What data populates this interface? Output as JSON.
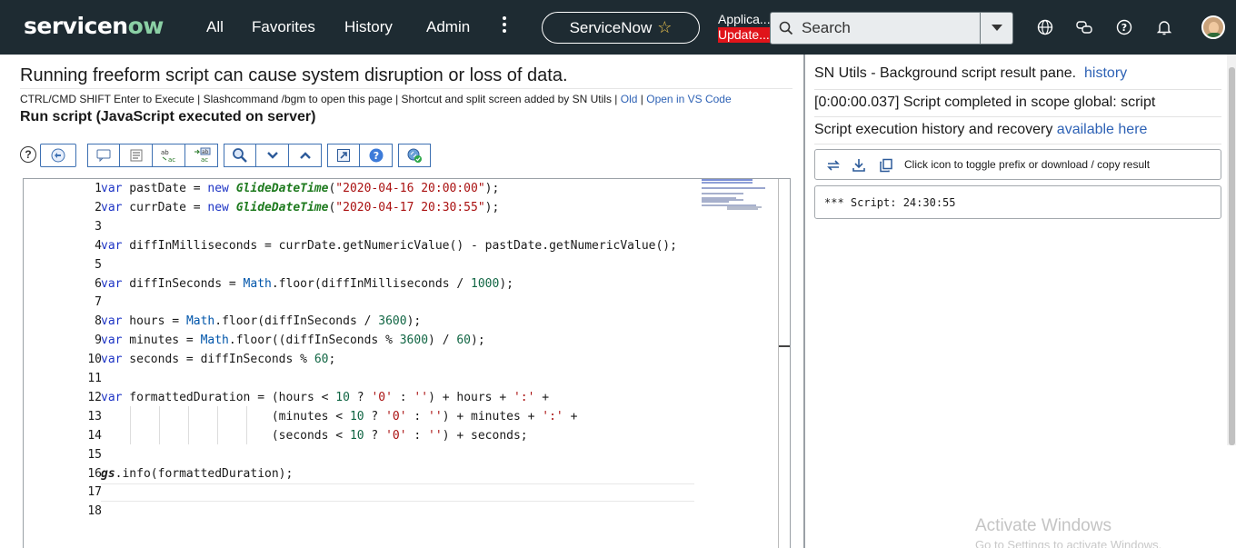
{
  "topnav": {
    "logo_service": "servicen",
    "logo_now": "ow",
    "links": [
      "All",
      "Favorites",
      "History",
      "Admin"
    ],
    "scope_label": "ServiceNow",
    "app_name": "Applica...",
    "update_badge": "Update...",
    "search_placeholder": "Search",
    "icons": [
      "globe-icon",
      "chat-icon",
      "help-icon",
      "bell-icon"
    ],
    "accent": "#8bd0a5",
    "update_color": "#e0141a"
  },
  "left": {
    "warning": "Running freeform script can cause system disruption or loss of data.",
    "hint_text": "CTRL/CMD SHIFT Enter to Execute | Slashcommand /bgm to open this page | Shortcut and split screen added by SN Utils | ",
    "hint_old": "Old",
    "hint_sep": " | ",
    "hint_vscode": "Open in VS Code",
    "run_label": "Run script (JavaScript executed on server)",
    "toolbar_buttons": [
      "comment-icon",
      "format-icon",
      "replace-icon",
      "replace-all-icon",
      "search-icon",
      "fold-icon",
      "unfold-icon",
      "fullscreen-icon",
      "help-icon",
      "run-icon"
    ]
  },
  "editor": {
    "line_numbers": [
      "1",
      "2",
      "3",
      "4",
      "5",
      "6",
      "7",
      "8",
      "9",
      "10",
      "11",
      "12",
      "13",
      "14",
      "15",
      "16",
      "17",
      "18"
    ],
    "lines": [
      "var pastDate = new GlideDateTime(\"2020-04-16 20:00:00\");",
      "var currDate = new GlideDateTime(\"2020-04-17 20:30:55\");",
      "",
      "var diffInMilliseconds = currDate.getNumericValue() - pastDate.getNumericValue();",
      "",
      "var diffInSeconds = Math.floor(diffInMilliseconds / 1000);",
      "",
      "var hours = Math.floor(diffInSeconds / 3600);",
      "var minutes = Math.floor((diffInSeconds % 3600) / 60);",
      "var seconds = diffInSeconds % 60;",
      "",
      "var formattedDuration = (hours < 10 ? '0' : '') + hours + ':' +",
      "                        (minutes < 10 ? '0' : '') + minutes + ':' +",
      "                        (seconds < 10 ? '0' : '') + seconds;",
      "",
      "gs.info(formattedDuration);",
      "",
      ""
    ]
  },
  "right": {
    "title": "SN Utils - Background script result pane.",
    "history_link": "history",
    "status": "[0:00:00.037] Script completed in scope global: script",
    "recovery_text": "Script execution history and recovery ",
    "recovery_link": "available here",
    "toggle_text": "Click icon to toggle prefix or download / copy result",
    "result": "*** Script: 24:30:55"
  },
  "watermark": {
    "title": "Activate Windows",
    "subtitle": "Go to Settings to activate Windows."
  }
}
